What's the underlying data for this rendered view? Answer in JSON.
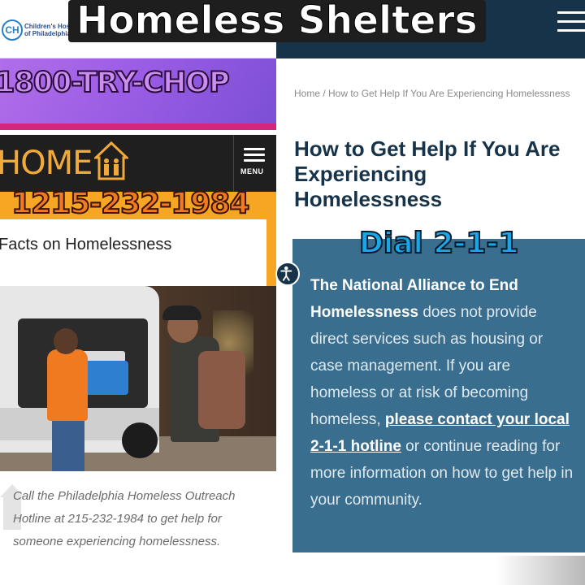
{
  "headline": "Homeless Shelters",
  "captions": {
    "chop_phone": "1800-TRY-CHOP",
    "hotline_phone": "1215-232-1984",
    "dial": "Dial 2-1-1"
  },
  "chop": {
    "logo_letters": "CH",
    "org_name": "Children's Hospital of Philadelphia"
  },
  "home_site": {
    "logo_text": "HOME",
    "menu_label": "MENU",
    "section_title": "Facts on Homelessness",
    "photo_caption": "Call the Philadelphia Homeless Outreach Hotline at 215-232-1984 to get help for someone experiencing homelessness."
  },
  "naeh_site": {
    "breadcrumb": "Home / How to Get Help If You Are Experiencing Homelessness",
    "title_line1": "How to Get Help If You Are",
    "title_line2": "Experiencing",
    "title_line3": "Homelessness",
    "body_bold": "The National Alliance to End Homelessness",
    "body_part1": " does not provide direct services such as housing or case management. If you are homeless or at risk of becoming homeless, ",
    "body_link": "please contact your local 2-1-1 hotline",
    "body_part2": " or continue reading for more information on how to get help in your community."
  },
  "colors": {
    "chop_purple": "#9b5de5",
    "home_orange": "#f6a623",
    "naeh_navy": "#17334a",
    "naeh_teal": "#3a6e8e"
  }
}
